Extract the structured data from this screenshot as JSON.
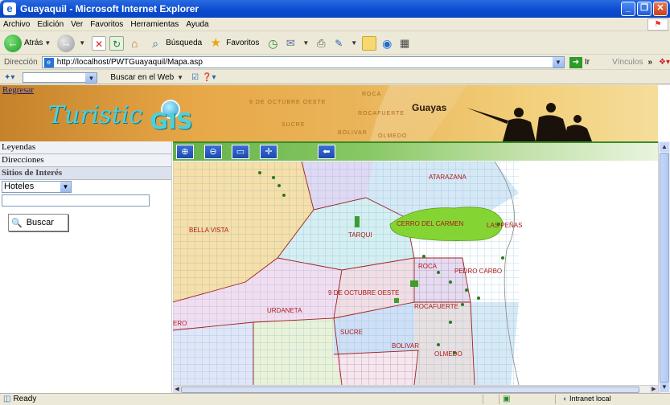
{
  "window": {
    "title": "Guayaquil - Microsoft Internet Explorer"
  },
  "menu": [
    "Archivo",
    "Edición",
    "Ver",
    "Favoritos",
    "Herramientas",
    "Ayuda"
  ],
  "toolbar": {
    "back": "Atrás",
    "search": "Búsqueda",
    "favorites": "Favoritos"
  },
  "address": {
    "label": "Dirección",
    "url": "http://localhost/PWTGuayaquil/Mapa.asp",
    "go": "Ir",
    "links": "Vínculos"
  },
  "searchbar": {
    "search_web": "Buscar en el Web"
  },
  "banner": {
    "back_link": "Regresar",
    "logo_word": "Turistic",
    "logo_gis": "GIS",
    "region": "Guayas",
    "faint_labels": [
      "9 DE OCTUBRE OESTE",
      "SUCRE",
      "BOLIVAR",
      "ROCA",
      "ROCAFUERTE",
      "OLMEDO"
    ]
  },
  "sidebar": {
    "items": [
      "Leyendas",
      "Direcciones",
      "Sitios de Interés"
    ],
    "category_selected": "Hoteles",
    "search_button": "Buscar"
  },
  "map": {
    "labels": [
      "ATARAZANA",
      "BELLA VISTA",
      "CERRO DEL CARMEN",
      "LAS PEÑAS",
      "TARQUI",
      "ROCA",
      "PEDRO CARBO",
      "9 DE OCTUBRE OESTE",
      "ROCAFUERTE",
      "URDANETA",
      "ERO",
      "SUCRE",
      "BOLIVAR",
      "OLMEDO"
    ]
  },
  "status": {
    "text": "Ready",
    "zone": "Intranet local"
  }
}
